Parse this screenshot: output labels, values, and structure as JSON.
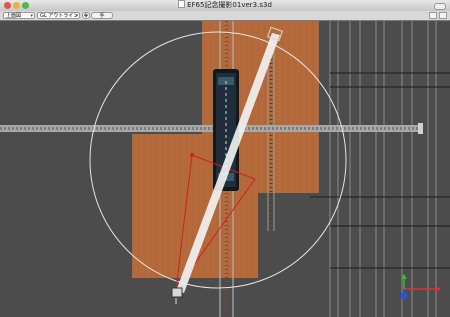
{
  "window": {
    "title": "EF65記念撮影01ver3.s3d"
  },
  "toolbar": {
    "view_select": "上面図",
    "render_select": "GL アウトライン",
    "toggle_label": "手"
  },
  "axis_gizmo": {
    "x_color": "#e03030",
    "y_color": "#30c030",
    "z_color": "#3050e0"
  },
  "colors": {
    "background": "#4a4a4a",
    "wood_platform": "#b56a3c",
    "selection": "#d02020",
    "rail": "#9a9a9a"
  }
}
